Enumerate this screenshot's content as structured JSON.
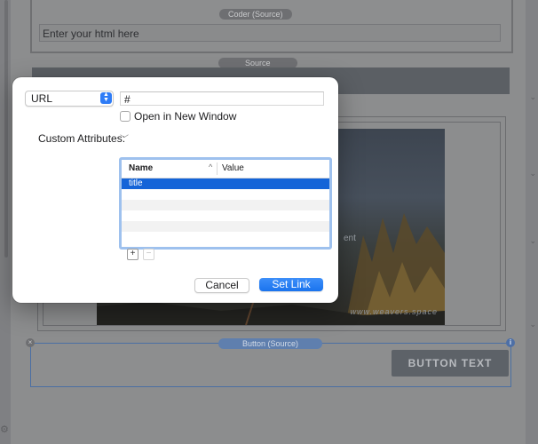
{
  "editor": {
    "coder_tag": "Coder (Source)",
    "coder_placeholder": "Enter your html here",
    "source_tag": "Source",
    "button_tag": "Button (Source)",
    "button_text": "BUTTON TEXT",
    "photo_text": "ent",
    "photo_brand": "www.weavers.space"
  },
  "dialog": {
    "link_type": "URL",
    "url_value": "#",
    "open_new_window_label": "Open in New Window",
    "open_new_window_checked": false,
    "custom_attributes_label": "Custom Attributes:",
    "table": {
      "columns": [
        "Name",
        "Value"
      ],
      "rows": [
        {
          "name": "title",
          "value": "",
          "selected": true
        }
      ]
    },
    "add_label": "+",
    "remove_label": "−",
    "cancel_label": "Cancel",
    "set_link_label": "Set Link"
  },
  "colors": {
    "accent": "#1a73ee",
    "selection": "#1464d8"
  }
}
